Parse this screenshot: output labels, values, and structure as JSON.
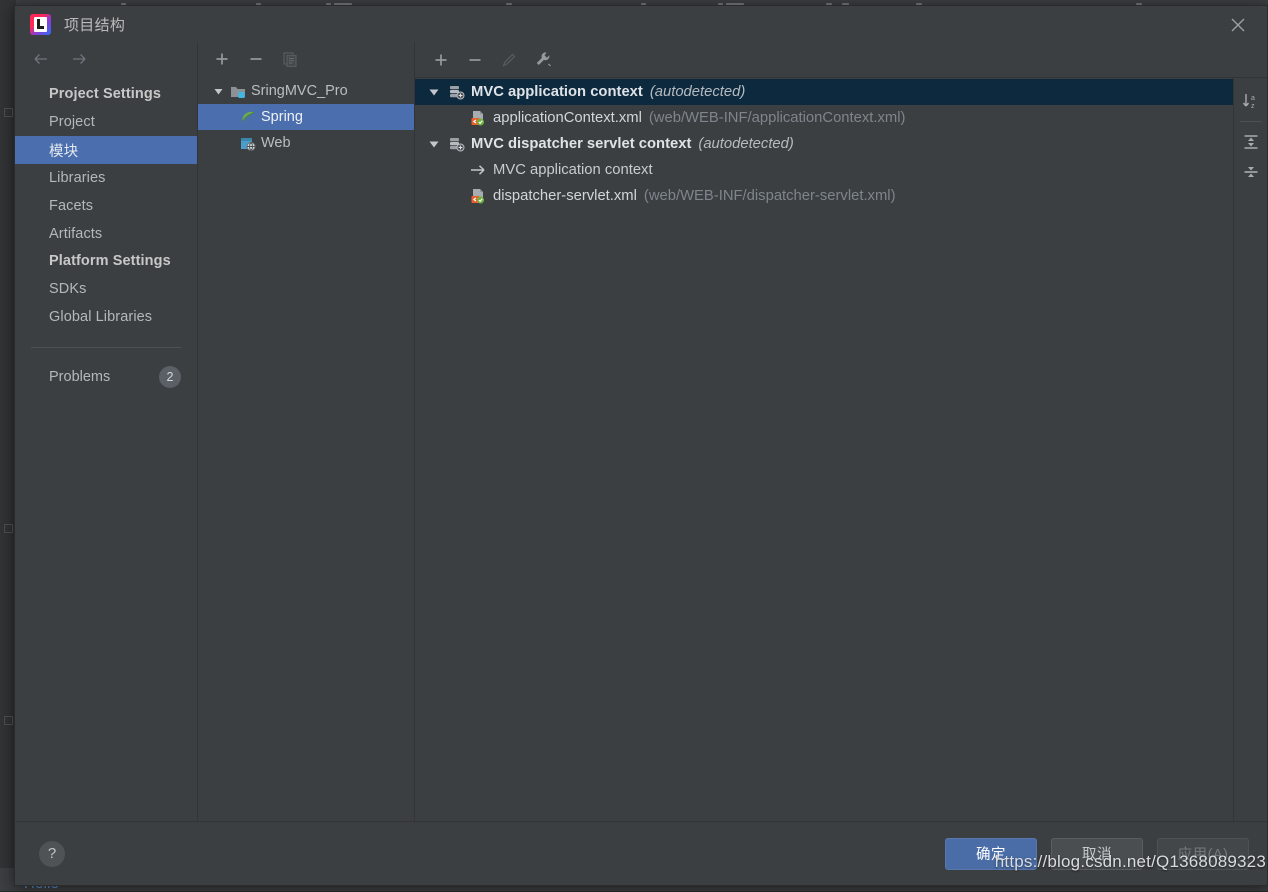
{
  "window": {
    "title": "项目结构",
    "logo_icon": "intellij-idea-logo",
    "close_icon": "close-icon"
  },
  "background": {
    "editor_text": "Hello",
    "watermark": "https://blog.csdn.net/Q1368089323"
  },
  "sidebar": {
    "back_icon": "arrow-left-icon",
    "forward_icon": "arrow-right-icon",
    "groups": [
      {
        "label": "Project Settings",
        "items": [
          {
            "label": "Project",
            "selected": false
          },
          {
            "label": "模块",
            "selected": true
          },
          {
            "label": "Libraries",
            "selected": false
          },
          {
            "label": "Facets",
            "selected": false
          },
          {
            "label": "Artifacts",
            "selected": false
          }
        ]
      },
      {
        "label": "Platform Settings",
        "items": [
          {
            "label": "SDKs",
            "selected": false
          },
          {
            "label": "Global Libraries",
            "selected": false
          }
        ]
      }
    ],
    "problems": {
      "label": "Problems",
      "count": "2"
    }
  },
  "modules": {
    "toolbar": [
      {
        "name": "add-module-button",
        "icon": "plus-icon",
        "enabled": true
      },
      {
        "name": "remove-module-button",
        "icon": "minus-icon",
        "enabled": true
      },
      {
        "name": "copy-module-button",
        "icon": "copy-icon",
        "enabled": false
      }
    ],
    "tree": [
      {
        "label": "SringMVC_Pro",
        "level": 1,
        "icon": "module-folder-icon",
        "expanded": true,
        "selected": false
      },
      {
        "label": "Spring",
        "level": 2,
        "icon": "spring-leaf-icon",
        "expanded": null,
        "selected": true
      },
      {
        "label": "Web",
        "level": 2,
        "icon": "web-facet-icon",
        "expanded": null,
        "selected": false
      }
    ]
  },
  "facets": {
    "toolbar": [
      {
        "name": "add-context-button",
        "icon": "plus-icon",
        "enabled": true
      },
      {
        "name": "remove-context-button",
        "icon": "minus-icon",
        "enabled": true
      },
      {
        "name": "edit-context-button",
        "icon": "pencil-icon",
        "enabled": false
      },
      {
        "name": "configure-button",
        "icon": "wrench-icon",
        "enabled": true
      }
    ],
    "side_buttons": [
      {
        "name": "sort-alphabetically-button",
        "icon": "sort-az-icon"
      },
      {
        "name": "expand-all-button",
        "icon": "expand-all-icon"
      },
      {
        "name": "collapse-all-button",
        "icon": "collapse-all-icon"
      }
    ],
    "tree": [
      {
        "kind": "context",
        "level": 1,
        "icon": "spring-context-icon",
        "name": "MVC application context",
        "note": "(autodetected)",
        "expanded": true,
        "selected": true
      },
      {
        "kind": "file",
        "level": 2,
        "icon": "spring-xml-file-icon",
        "name": "applicationContext.xml",
        "path": "(web/WEB-INF/applicationContext.xml)",
        "selected": false
      },
      {
        "kind": "context",
        "level": 1,
        "icon": "spring-context-icon",
        "name": "MVC dispatcher servlet context",
        "note": "(autodetected)",
        "expanded": true,
        "selected": false
      },
      {
        "kind": "ref",
        "level": 2,
        "icon": "arrow-right-ref-icon",
        "name": "MVC application context",
        "selected": false
      },
      {
        "kind": "file",
        "level": 2,
        "icon": "spring-xml-file-icon",
        "name": "dispatcher-servlet.xml",
        "path": "(web/WEB-INF/dispatcher-servlet.xml)",
        "selected": false
      }
    ]
  },
  "footer": {
    "help_icon": "question-mark-icon",
    "ok_label": "确定",
    "cancel_label": "取消",
    "apply_label": "应用(A)"
  },
  "colors": {
    "dialog_bg": "#3c3f41",
    "selection_blue": "#4b6eaf",
    "inactive_selection": "#0d293e",
    "primary_button": "#4a6da7",
    "text": "#b3b8bd"
  }
}
